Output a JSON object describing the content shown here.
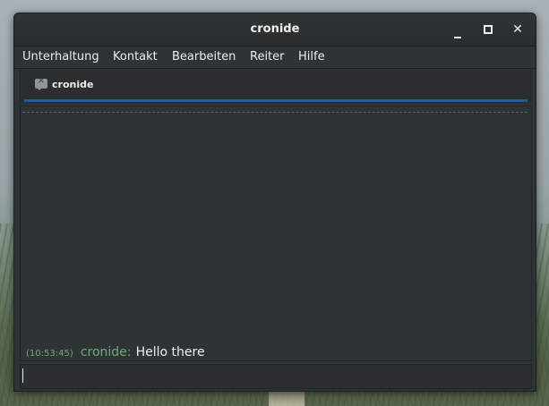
{
  "window": {
    "title": "cronide",
    "controls": {
      "minimize_icon": "minimize-icon",
      "maximize_icon": "maximize-icon",
      "close_glyph": "✕"
    }
  },
  "menubar": {
    "items": [
      "Unterhaltung",
      "Kontakt",
      "Bearbeiten",
      "Reiter",
      "Hilfe"
    ]
  },
  "tabs": [
    {
      "label": "cronide",
      "icon": "chat-bubble-icon",
      "icon_glyph": "✕",
      "active": true
    }
  ],
  "conversation": {
    "messages": [
      {
        "time": "(10:53:45)",
        "sender": "cronide:",
        "text": "Hello there"
      }
    ]
  },
  "input": {
    "value": ""
  },
  "colors": {
    "accent": "#215d9c",
    "sender": "#73a87b",
    "window_bg": "#2e3436",
    "text": "#eeeeec"
  }
}
